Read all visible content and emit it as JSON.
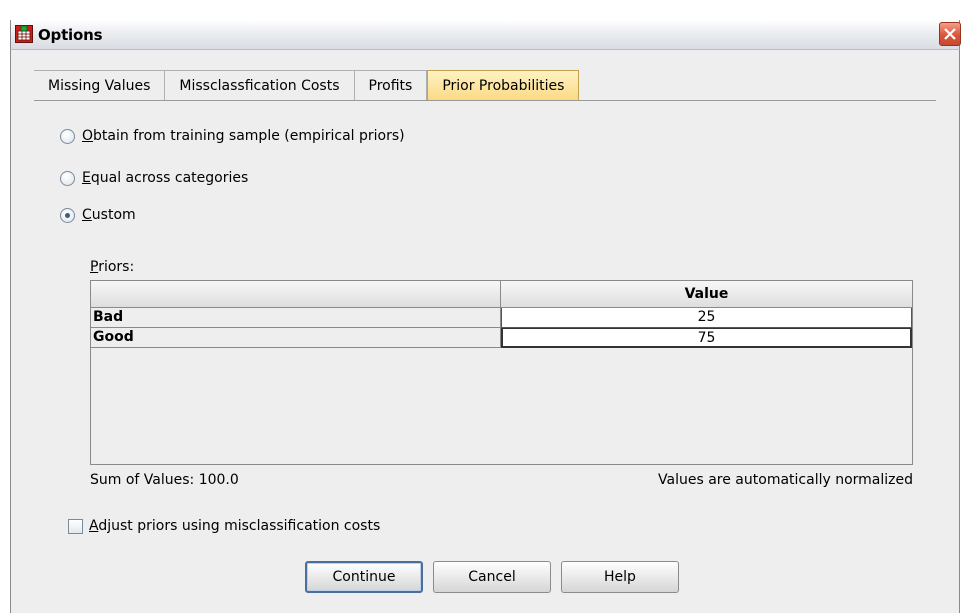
{
  "window": {
    "title": "Options",
    "close_icon": "close-icon",
    "app_icon": "spss-dialog-icon"
  },
  "tabs": [
    {
      "label": "Missing Values",
      "active": false
    },
    {
      "label": "Missclassfication Costs",
      "active": false
    },
    {
      "label": "Profits",
      "active": false
    },
    {
      "label": "Prior Probabilities",
      "active": true
    }
  ],
  "radios": [
    {
      "mnemonic": "O",
      "rest": "btain from training sample (empirical priors)",
      "checked": false
    },
    {
      "mnemonic": "E",
      "rest": "qual across categories",
      "checked": false
    },
    {
      "mnemonic": "C",
      "rest": "ustom",
      "checked": true
    }
  ],
  "priors": {
    "label_mnemonic": "P",
    "label_rest": "riors:",
    "column_header": "Value",
    "rows": [
      {
        "name": "Bad",
        "value": "25"
      },
      {
        "name": "Good",
        "value": "75"
      }
    ],
    "sum_text": "Sum of Values: 100.0",
    "normalized_text": "Values are automatically normalized"
  },
  "adjust": {
    "mnemonic": "A",
    "rest": "djust priors using misclassification costs",
    "checked": false
  },
  "buttons": {
    "continue": "Continue",
    "cancel": "Cancel",
    "help": "Help"
  },
  "colors": {
    "active_tab": "#fbd985",
    "dialog_bg": "#eeeeee",
    "close_button": "#d8563a",
    "default_button_border": "#4b6f9b"
  }
}
